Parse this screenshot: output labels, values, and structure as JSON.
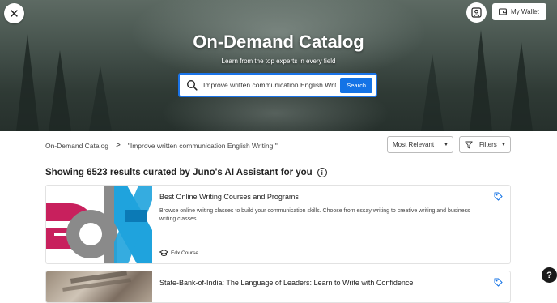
{
  "header": {
    "close_icon": "close-icon",
    "profile_icon": "user-profile-icon",
    "wallet_icon": "wallet-icon",
    "wallet_label": "My Wallet"
  },
  "hero": {
    "title": "On-Demand Catalog",
    "subtitle": "Learn from the top experts in every field"
  },
  "search": {
    "value": "Improve written communication English Writing",
    "button_label": "Search",
    "icon": "search-icon"
  },
  "breadcrumb": {
    "root": "On-Demand Catalog",
    "separator": ">",
    "current": "\"Improve written communication English Writing \""
  },
  "sort": {
    "selected": "Most Relevant",
    "caret": "▼"
  },
  "filters": {
    "label": "Filters",
    "icon": "filter-icon",
    "caret": "▼"
  },
  "results": {
    "heading": "Showing 6523 results curated by Juno's AI Assistant for you",
    "info_icon": "info-icon",
    "info_glyph": "i"
  },
  "courses": [
    {
      "title": "Best Online Writing Courses and Programs",
      "description": "Browse online writing classes to build your communication skills. Choose from essay writing to creative writing and business writing classes.",
      "provider": "Edx Course",
      "provider_icon": "graduation-cap-icon",
      "tag_icon": "tag-icon"
    },
    {
      "title": "State-Bank-of-India: The Language of Leaders: Learn to Write with Confidence",
      "tag_icon": "tag-icon"
    }
  ],
  "help": {
    "glyph": "?",
    "icon": "help-icon"
  },
  "colors": {
    "accent": "#1473e6",
    "edx_magenta": "#c8205d",
    "edx_blue": "#1fa3dd",
    "edx_gray": "#8a8a8a"
  }
}
